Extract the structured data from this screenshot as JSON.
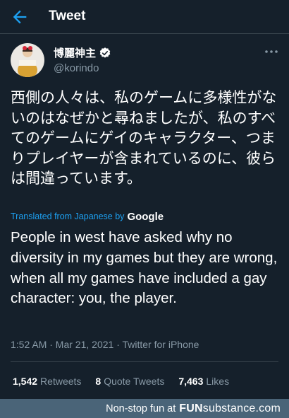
{
  "header": {
    "title": "Tweet",
    "back_icon": "arrow-left-icon"
  },
  "author": {
    "display_name": "博麗神主",
    "handle": "@korindo",
    "verified_icon": "verified-badge-icon",
    "more_icon": "more-horizontal-icon"
  },
  "tweet": {
    "text_original": "西側の人々は、私のゲームに多様性がないのはなぜかと尋ねましたが、私のすべてのゲームにゲイのキャラクター、つまりプレイヤーが含まれているのに、彼らは間違っています。",
    "translated_label": "Translated from Japanese by",
    "translated_by": "Google",
    "text_translated": "People in west have asked why no diversity in my games but they are wrong, when all my games have included a gay character: you, the player.",
    "timestamp": "1:52 AM · Mar 21, 2021 · Twitter for iPhone"
  },
  "stats": {
    "retweets_count": "1,542",
    "retweets_label": "Retweets",
    "quotes_count": "8",
    "quotes_label": "Quote Tweets",
    "likes_count": "7,463",
    "likes_label": "Likes"
  },
  "footer": {
    "text": "Non-stop fun at",
    "brand_bold": "FUN",
    "brand_rest": "substance",
    "brand_suffix": ".com"
  },
  "colors": {
    "background": "#15202b",
    "accent": "#1da1f2",
    "muted": "#8899a6",
    "divider": "#38444d",
    "footer_bg": "#4a6478"
  }
}
